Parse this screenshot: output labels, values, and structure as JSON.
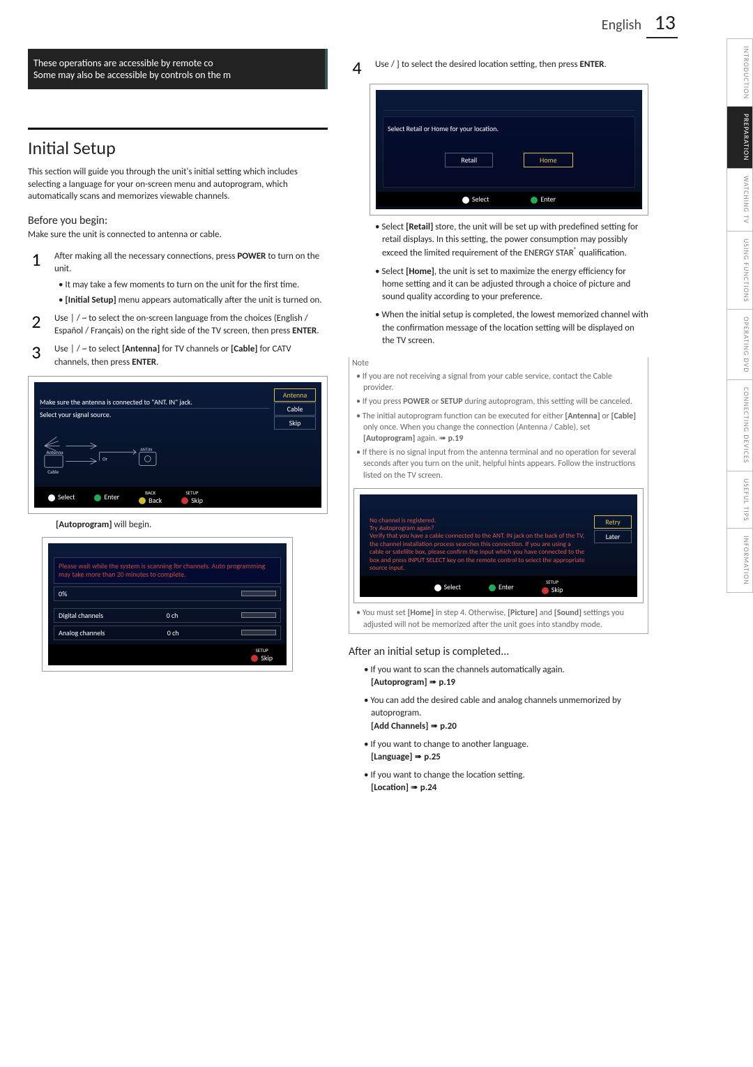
{
  "header": {
    "lang": "English",
    "page": "13"
  },
  "banner": {
    "line1": "These operations are accessible by remote co",
    "line2": "Some may also be accessible by controls on the m"
  },
  "h1": "Initial Setup",
  "intro": "This section will guide you through the unit's initial setting which includes selecting a language for your on-screen menu and autoprogram, which automatically scans and memorizes viewable channels.",
  "before": {
    "heading": "Before you begin:",
    "line": "Make sure the unit is connected to antenna or cable."
  },
  "steps": {
    "s1": {
      "n": "1",
      "text": "After making all the necessary connections, press ",
      "bold": "POWER",
      "text2": " to turn on the unit.",
      "sub1": "It may take a few moments to turn on the unit for the first time.",
      "sub2a": "[Initial Setup]",
      "sub2b": " menu appears automatically after the unit is turned on."
    },
    "s2": {
      "n": "2",
      "text": "Use  |  / ~  to select the on-screen language from the choices (English / Español / Français) on the right side of the TV screen, then press ",
      "bold": "ENTER",
      "text2": "."
    },
    "s3": {
      "n": "3",
      "text": "Use  |  / ~  to select ",
      "b1": "[Antenna]",
      "mid": " for TV channels or ",
      "b2": "[Cable]",
      "tail": " for CATV channels, then press ",
      "bold": "ENTER",
      "text2": "."
    },
    "s4": {
      "n": "4",
      "text": "Use    / }   to select the desired location setting, then press ",
      "bold": "ENTER",
      "text2": "."
    }
  },
  "screen1": {
    "msg1": "Make sure the antenna is connected to \"ANT. IN\" jack.",
    "msg2": "Select your signal source.",
    "opts": {
      "antenna": "Antenna",
      "cable": "Cable",
      "skip": "Skip"
    },
    "labels": {
      "antenna": "Antenna",
      "cable": "Cable",
      "or": "Or",
      "antin": "ANT.IN"
    },
    "footer": {
      "select": "Select",
      "enter": "Enter",
      "back": "Back",
      "skip": "Skip",
      "backlbl": "BACK",
      "setuplbl": "SETUP"
    }
  },
  "autop": {
    "lead": "[Autoprogram]",
    "tail": " will begin."
  },
  "screen2": {
    "msg": "Please wait while the system is scanning for channels. Auto programming may take more than 20 minutes to complete.",
    "pct": "0%",
    "digital": "Digital channels",
    "analog": "Analog channels",
    "zero": "0 ch",
    "skip": "Skip",
    "setuplbl": "SETUP"
  },
  "screen3": {
    "head": "Select  Retail  or  Home  for your location.",
    "retail": "Retail",
    "home": "Home",
    "footer": {
      "select": "Select",
      "enter": "Enter"
    }
  },
  "locbul": {
    "b1a": "Select ",
    "b1b": "[Retail]",
    "b1c": " store, the unit will be set up with predefined setting for retail displays. In this setting, the power consumption may possibly exceed the limited requirement of the ENERGY STAR",
    "b1d": " qualification.",
    "b2a": "Select ",
    "b2b": "[Home]",
    "b2c": ", the unit is set to maximize the energy efficiency for home setting and it can be adjusted through a choice of picture and sound quality according to your preference.",
    "b3": "When the initial setup is completed, the lowest memorized channel with the confirmation message of the location setting will be displayed on the TV screen."
  },
  "note": {
    "h": "Note",
    "n1": "If you are not receiving a signal from your cable service, contact the Cable provider.",
    "n2a": "If you press ",
    "n2b": "POWER",
    "n2c": " or ",
    "n2d": "SETUP",
    "n2e": " during autoprogram, this setting will be canceled.",
    "n3a": "The initial autoprogram function can be executed for either ",
    "n3b": "[Antenna]",
    "n3c": " or ",
    "n3d": "[Cable]",
    "n3e": " only once. When you change the connection (Antenna / Cable), set ",
    "n3f": "[Autoprogram]",
    "n3g": " again. ",
    "n3h": "p.19",
    "n4": "If there is no signal input from the antenna terminal and no operation for several seconds after you turn on the unit, helpful hints appears. Follow the instructions listed on the TV screen."
  },
  "screen4": {
    "retry": "Retry",
    "later": "Later",
    "msg": "No channel is registered.\nTry Autoprogram again?\nVerify that you have a cable connected to the  ANT. IN   jack on the back of the TV, the channel installation process searches this connection. If you are using a cable or satellite box, please confirm the input which you have connected to the box and press  INPUT SELECT  key on the remote control to select the appropriate source input.",
    "footer": {
      "select": "Select",
      "enter": "Enter",
      "skip": "Skip",
      "setuplbl": "SETUP"
    }
  },
  "noteend": {
    "a": "You must set ",
    "b": "[Home]",
    "c": " in step 4. Otherwise, ",
    "d": "[Picture]",
    "e": " and ",
    "f": "[Sound]",
    "g": " settings you adjusted will not be memorized after the unit goes into standby mode."
  },
  "after": {
    "h": "After an initial setup is completed...",
    "b1": "If you want to scan the channels automatically again.",
    "b1r": "[Autoprogram]",
    "b1p": "p.19",
    "b2": "You can add the desired cable and analog channels unmemorized by autoprogram.",
    "b2r": "[Add Channels]",
    "b2p": "p.20",
    "b3": "If you want to change to another language.",
    "b3r": "[Language]",
    "b3p": "p.25",
    "b4": "If you want to change the location setting.",
    "b4r": "[Location]",
    "b4p": "p.24"
  },
  "tabs": {
    "t1": "INTRODUCTION",
    "t2": "PREPARATION",
    "t3": "WATCHING TV",
    "t4": "USING FUNCTIONS",
    "t5": "OPERATING DVD",
    "t6": "CONNECTING DEVICES",
    "t7": "USEFUL TIPS",
    "t8": "INFORMATION"
  }
}
